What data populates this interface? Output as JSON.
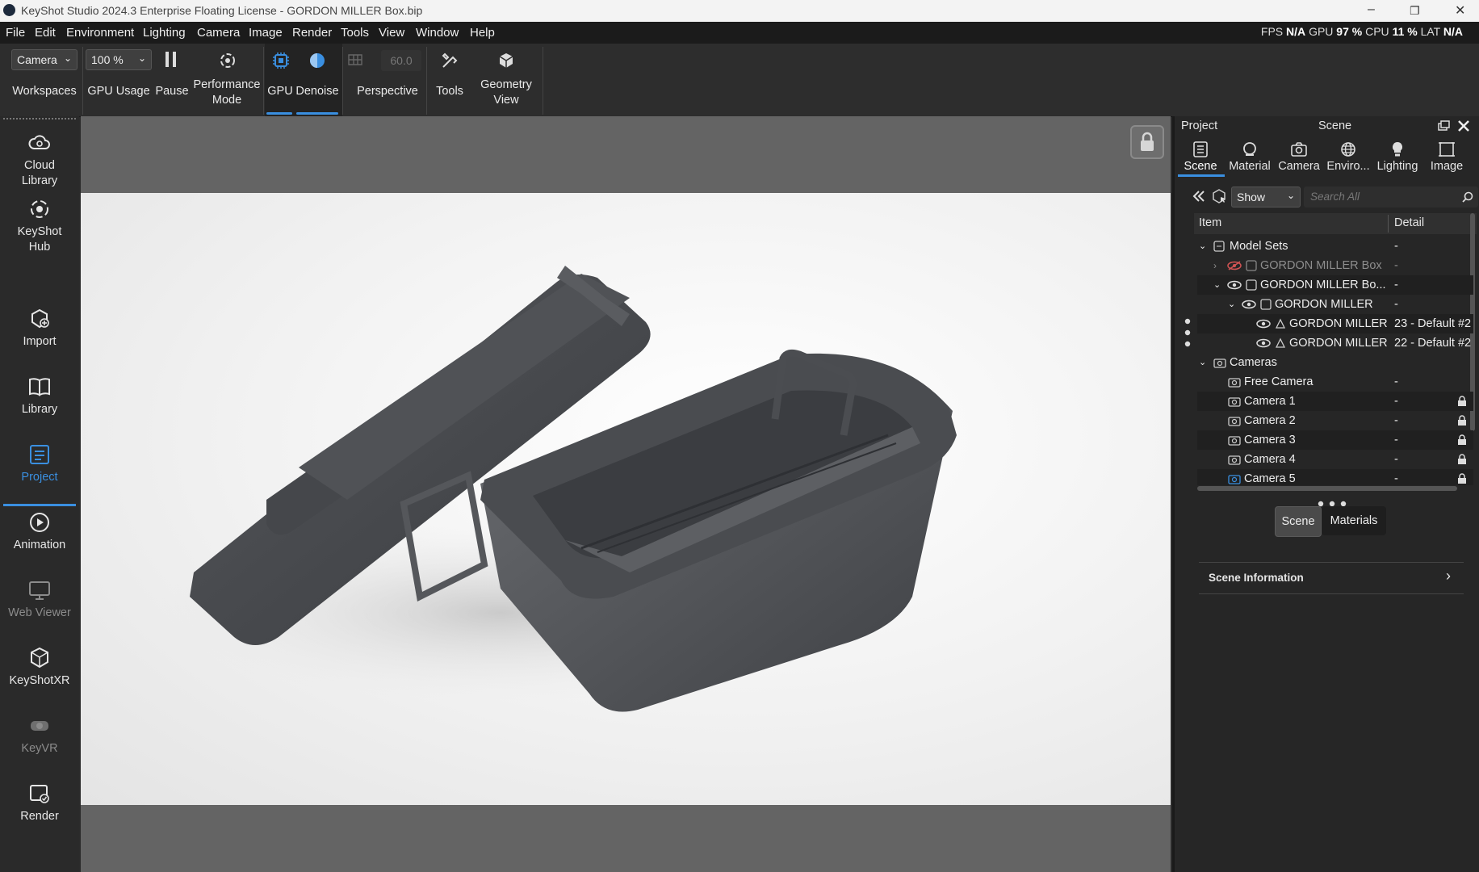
{
  "window": {
    "title": "KeyShot Studio 2024.3 Enterprise Floating License  -  GORDON MILLER Box.bip",
    "controls": [
      "–",
      "❐",
      "✕"
    ]
  },
  "menu": [
    "File",
    "Edit",
    "Environment",
    "Lighting",
    "Camera",
    "Image",
    "Render",
    "Tools",
    "View",
    "Window",
    "Help"
  ],
  "perf": {
    "fps_label": "FPS",
    "fps_value": "N/A",
    "gpu_label": "GPU",
    "gpu_value": "97 %",
    "cpu_label": "CPU",
    "cpu_value": "11 %",
    "lat_label": "LAT",
    "lat_value": "N/A"
  },
  "ribbon": {
    "workspace_select": "Camera",
    "workspaces_label": "Workspaces",
    "gpu_usage_select": "100 %",
    "gpu_usage_label": "GPU Usage",
    "pause_label": "Pause",
    "performance_label": "Performance\nMode",
    "gpu_label": "GPU",
    "denoise_label": "Denoise",
    "fov_value": "60.0",
    "perspective_label": "Perspective",
    "tools_label": "Tools",
    "geometry_label": "Geometry\nView"
  },
  "left_sidebar": {
    "items": [
      {
        "label": "Cloud\nLibrary"
      },
      {
        "label": "KeyShot\nHub"
      },
      {
        "label": "Import"
      },
      {
        "label": "Library"
      },
      {
        "label": "Project"
      },
      {
        "label": "Animation"
      },
      {
        "label": "Web Viewer"
      },
      {
        "label": "KeyShotXR"
      },
      {
        "label": "KeyVR"
      },
      {
        "label": "Render"
      }
    ],
    "active": "Project"
  },
  "right_panel": {
    "header_left": "Project",
    "header_center": "Scene",
    "tabs": [
      "Scene",
      "Material",
      "Camera",
      "Enviro...",
      "Lighting",
      "Image"
    ],
    "active_tab": "Scene",
    "show_select": "Show",
    "search_placeholder": "Search All",
    "columns": {
      "item": "Item",
      "detail": "Detail"
    },
    "rows": [
      {
        "label": "Model Sets",
        "detail": "-"
      },
      {
        "label": "GORDON MILLER Box",
        "detail": "-"
      },
      {
        "label": "GORDON MILLER Bo...",
        "detail": "-"
      },
      {
        "label": "GORDON MILLER",
        "detail": "-"
      },
      {
        "label": "GORDON MILLER",
        "detail": "23 - Default  #2"
      },
      {
        "label": "GORDON MILLER",
        "detail": "22 - Default  #2"
      },
      {
        "label": "Cameras",
        "detail": ""
      },
      {
        "label": "Free Camera",
        "detail": "-"
      },
      {
        "label": "Camera 1",
        "detail": "-"
      },
      {
        "label": "Camera 2",
        "detail": "-"
      },
      {
        "label": "Camera 3",
        "detail": "-"
      },
      {
        "label": "Camera 4",
        "detail": "-"
      },
      {
        "label": "Camera 5",
        "detail": "-"
      }
    ],
    "bottom_tabs": [
      "Scene",
      "Materials"
    ],
    "scene_information": "Scene Information"
  },
  "colors": {
    "accent": "#3a8fe0",
    "panel_bg": "#262626",
    "viewport_bg": "#646464",
    "model_gray": "#5a5c60"
  }
}
